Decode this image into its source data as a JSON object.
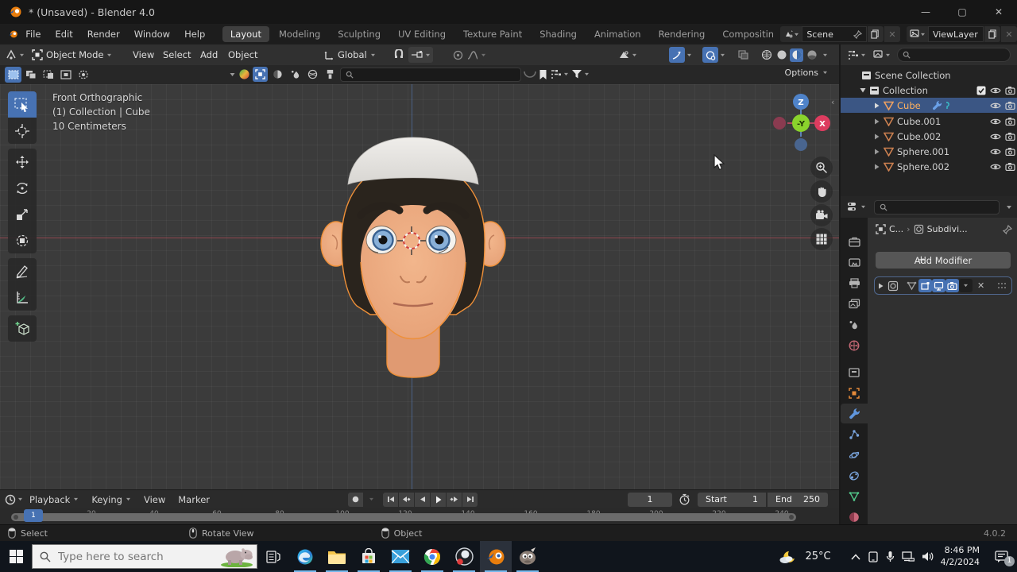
{
  "window": {
    "title": "* (Unsaved) - Blender 4.0"
  },
  "topbar": {
    "menus": [
      "File",
      "Edit",
      "Render",
      "Window",
      "Help"
    ],
    "workspaces": [
      "Layout",
      "Modeling",
      "Sculpting",
      "UV Editing",
      "Texture Paint",
      "Shading",
      "Animation",
      "Rendering",
      "Compositing"
    ],
    "active_workspace": "Layout",
    "scene_value": "Scene",
    "view_layer_value": "ViewLayer"
  },
  "tool_header": {
    "mode": "Object Mode",
    "menus": [
      "View",
      "Select",
      "Add",
      "Object"
    ],
    "orientation": "Global"
  },
  "tool_settings": {
    "options_label": "Options"
  },
  "viewport": {
    "overlay": {
      "line1": "Front Orthographic",
      "line2": "(1) Collection | Cube",
      "line3": "10 Centimeters"
    },
    "gizmo": {
      "z": "Z",
      "neg_y": "-Y",
      "x": "X"
    }
  },
  "outliner": {
    "root": "Scene Collection",
    "collection": "Collection",
    "items": [
      {
        "label": "Cube",
        "selected": true
      },
      {
        "label": "Cube.001",
        "selected": false
      },
      {
        "label": "Cube.002",
        "selected": false
      },
      {
        "label": "Sphere.001",
        "selected": false
      },
      {
        "label": "Sphere.002",
        "selected": false
      }
    ]
  },
  "properties": {
    "breadcrumb_object": "C...",
    "breadcrumb_modifier": "Subdivi...",
    "add_modifier": "Add Modifier"
  },
  "timeline": {
    "menus": [
      "Playback",
      "Keying",
      "View",
      "Marker"
    ],
    "current_frame": "1",
    "start_label": "Start",
    "start_value": "1",
    "end_label": "End",
    "end_value": "250",
    "ruler_ticks": [
      "20",
      "40",
      "60",
      "80",
      "100",
      "120",
      "140",
      "160",
      "180",
      "200",
      "220",
      "240"
    ]
  },
  "status": {
    "items": [
      {
        "label": "Select"
      },
      {
        "label": "Rotate View"
      },
      {
        "label": "Object"
      }
    ],
    "version": "4.0.2"
  },
  "taskbar": {
    "search_placeholder": "Type here to search",
    "temperature": "25°C",
    "time": "8:46 PM",
    "date": "4/2/2024",
    "badge": "1"
  },
  "colors": {
    "accent_blue": "#4772b3",
    "selection_row": "#3b5684",
    "active_object_text": "#ffb15e",
    "blender_orange": "#e87d0d",
    "axis_x": "#e8566d",
    "axis_z": "#5383c3",
    "axis_y": "#7ec832",
    "viewport_bg": "#3b3b3b"
  }
}
